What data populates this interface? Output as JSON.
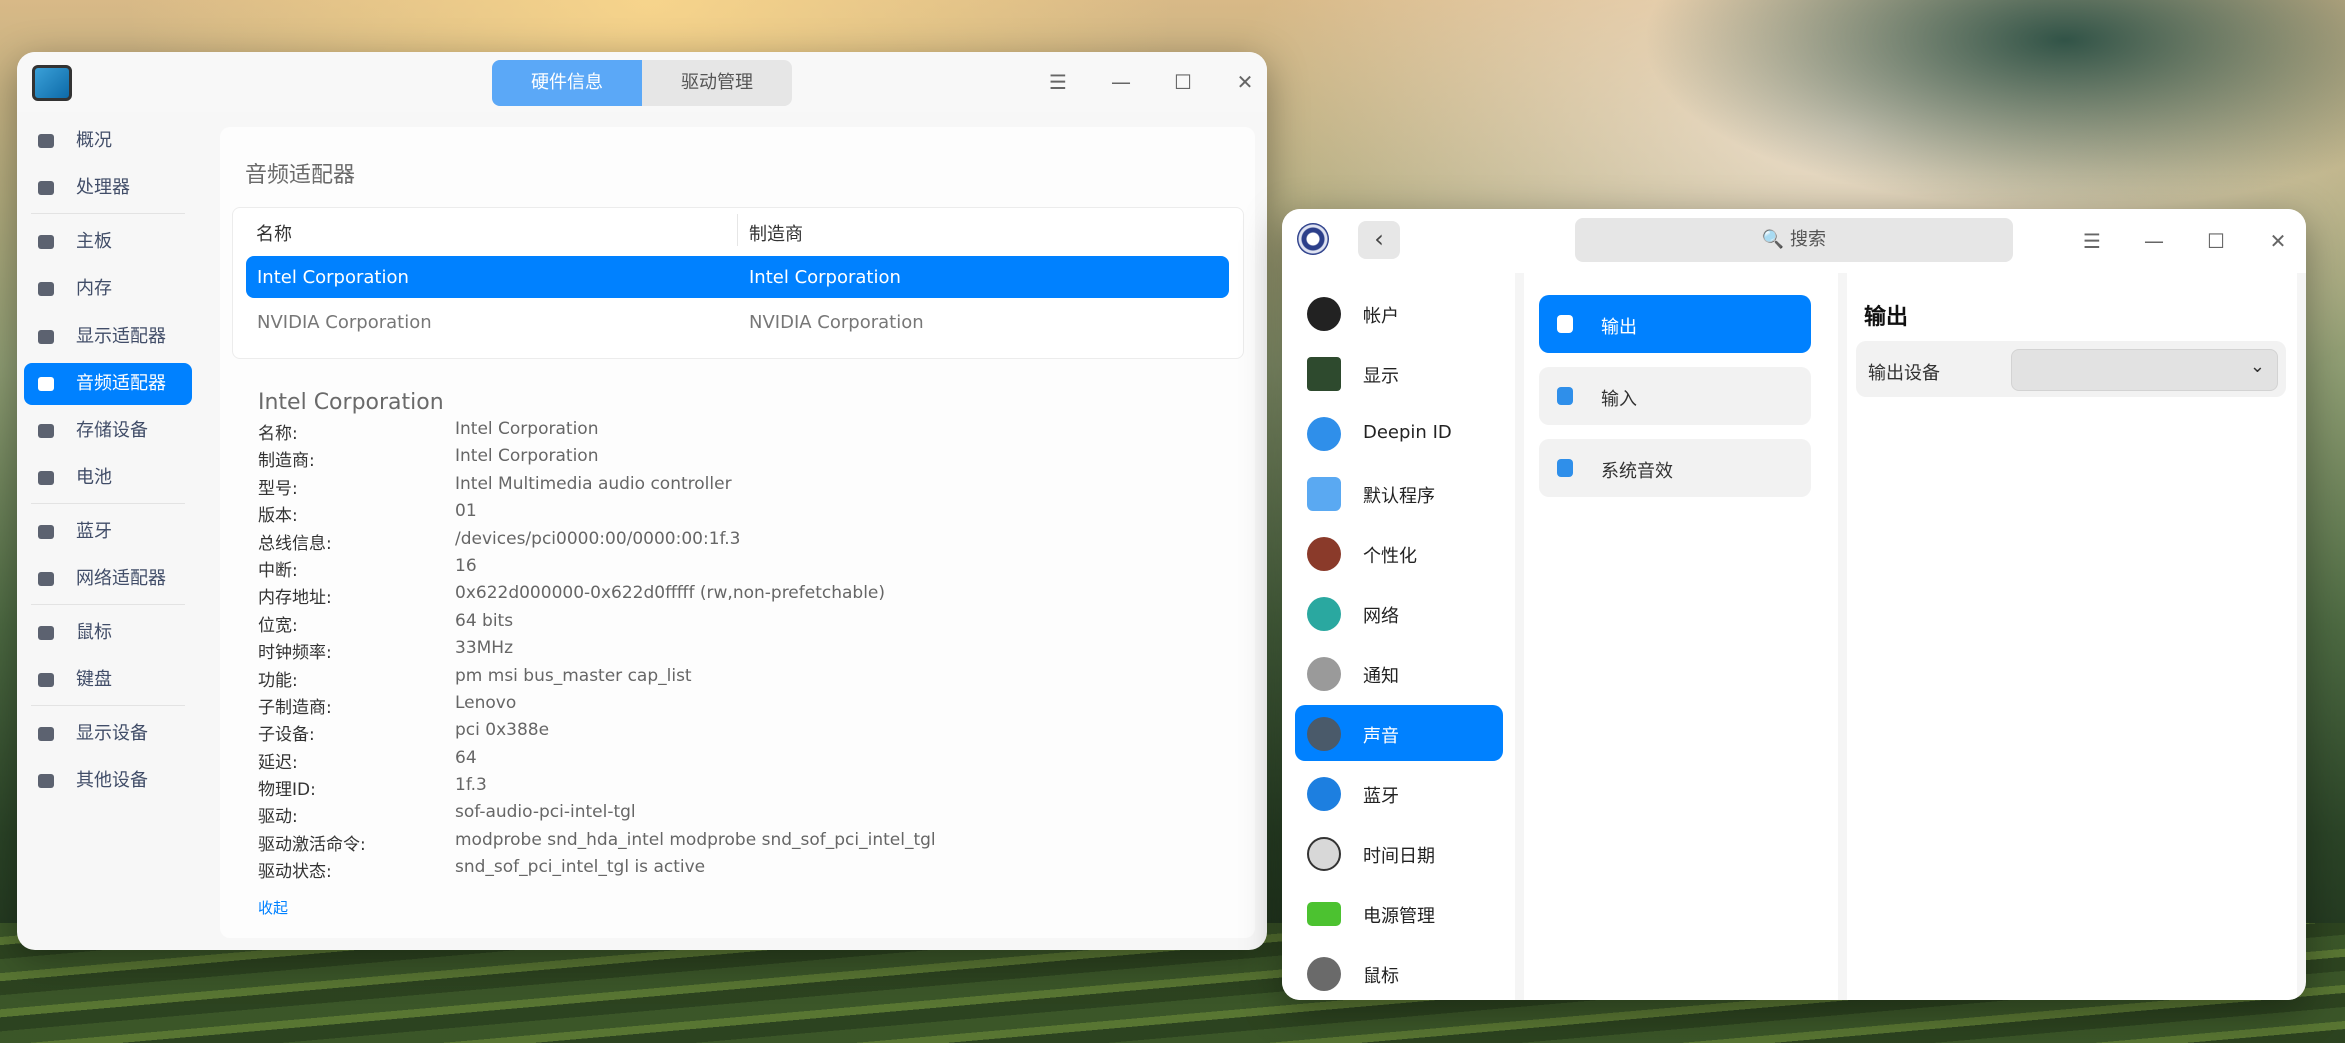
{
  "device_manager": {
    "tabs": [
      {
        "label": "硬件信息"
      },
      {
        "label": "驱动管理"
      }
    ],
    "window_buttons": {
      "menu": "☰",
      "minimize": "—",
      "maximize": "☐",
      "close": "✕"
    },
    "sidebar": [
      {
        "label": "概况",
        "icon": "monitor-icon"
      },
      {
        "label": "处理器",
        "icon": "cpu-icon"
      },
      {
        "label": "主板",
        "icon": "motherboard-icon"
      },
      {
        "label": "内存",
        "icon": "memory-icon"
      },
      {
        "label": "显示适配器",
        "icon": "display-adapter-icon"
      },
      {
        "label": "音频适配器",
        "icon": "audio-icon",
        "active": true
      },
      {
        "label": "存储设备",
        "icon": "storage-icon"
      },
      {
        "label": "电池",
        "icon": "battery-icon"
      },
      {
        "label": "蓝牙",
        "icon": "bluetooth-icon"
      },
      {
        "label": "网络适配器",
        "icon": "network-icon"
      },
      {
        "label": "鼠标",
        "icon": "mouse-icon"
      },
      {
        "label": "键盘",
        "icon": "keyboard-icon"
      },
      {
        "label": "显示设备",
        "icon": "display-device-icon"
      },
      {
        "label": "其他设备",
        "icon": "other-device-icon"
      }
    ],
    "section_title": "音频适配器",
    "table": {
      "headers": [
        "名称",
        "制造商"
      ],
      "rows": [
        [
          "Intel Corporation",
          "Intel Corporation"
        ],
        [
          "NVIDIA Corporation",
          "NVIDIA Corporation"
        ]
      ]
    },
    "detail_title": "Intel Corporation",
    "details": [
      {
        "k": "名称:",
        "v": "Intel Corporation"
      },
      {
        "k": "制造商:",
        "v": "Intel Corporation"
      },
      {
        "k": "型号:",
        "v": "Intel Multimedia audio controller"
      },
      {
        "k": "版本:",
        "v": "01"
      },
      {
        "k": "总线信息:",
        "v": "/devices/pci0000:00/0000:00:1f.3"
      },
      {
        "k": "中断:",
        "v": "16"
      },
      {
        "k": "内存地址:",
        "v": "0x622d000000-0x622d0fffff (rw,non-prefetchable)"
      },
      {
        "k": "位宽:",
        "v": "64 bits"
      },
      {
        "k": "时钟频率:",
        "v": "33MHz"
      },
      {
        "k": "功能:",
        "v": "pm msi bus_master cap_list"
      },
      {
        "k": "子制造商:",
        "v": "Lenovo"
      },
      {
        "k": "子设备:",
        "v": "pci 0x388e"
      },
      {
        "k": "延迟:",
        "v": "64"
      },
      {
        "k": "物理ID:",
        "v": "1f.3"
      },
      {
        "k": "驱动:",
        "v": "sof-audio-pci-intel-tgl"
      },
      {
        "k": "驱动激活命令:",
        "v": "modprobe snd_hda_intel modprobe snd_sof_pci_intel_tgl"
      },
      {
        "k": "驱动状态:",
        "v": "snd_sof_pci_intel_tgl is active"
      }
    ],
    "collapse_link": "收起"
  },
  "control_center": {
    "back": "‹",
    "search_placeholder": "🔍 搜索",
    "window_buttons": {
      "menu": "☰",
      "minimize": "—",
      "maximize": "☐",
      "close": "✕"
    },
    "nav": [
      {
        "label": "帐户",
        "icon": "account-icon",
        "color": "#222222"
      },
      {
        "label": "显示",
        "icon": "display-icon",
        "color": "#2e4a2e"
      },
      {
        "label": "Deepin ID",
        "icon": "cloud-icon",
        "color": "#2f8fea"
      },
      {
        "label": "默认程序",
        "icon": "default-apps-icon",
        "color": "#5aa9f2"
      },
      {
        "label": "个性化",
        "icon": "personalization-icon",
        "color": "#8a3a2a"
      },
      {
        "label": "网络",
        "icon": "network-globe-icon",
        "color": "#2aa8a0"
      },
      {
        "label": "通知",
        "icon": "bell-icon",
        "color": "#9a9a9a"
      },
      {
        "label": "声音",
        "icon": "speaker-icon",
        "color": "#4a5a6a",
        "active": true
      },
      {
        "label": "蓝牙",
        "icon": "bluetooth-icon",
        "color": "#1d7fe0"
      },
      {
        "label": "时间日期",
        "icon": "clock-icon",
        "color": "#d8d8d8"
      },
      {
        "label": "电源管理",
        "icon": "battery-icon",
        "color": "#4cc230"
      },
      {
        "label": "鼠标",
        "icon": "mouse-icon",
        "color": "#6a6a6a"
      }
    ],
    "sound_menu": [
      {
        "label": "输出",
        "icon": "speaker-output-icon",
        "active": true
      },
      {
        "label": "输入",
        "icon": "microphone-icon"
      },
      {
        "label": "系统音效",
        "icon": "sound-effects-icon"
      }
    ],
    "panel_title": "输出",
    "output_device_label": "输出设备",
    "output_device_value": ""
  }
}
